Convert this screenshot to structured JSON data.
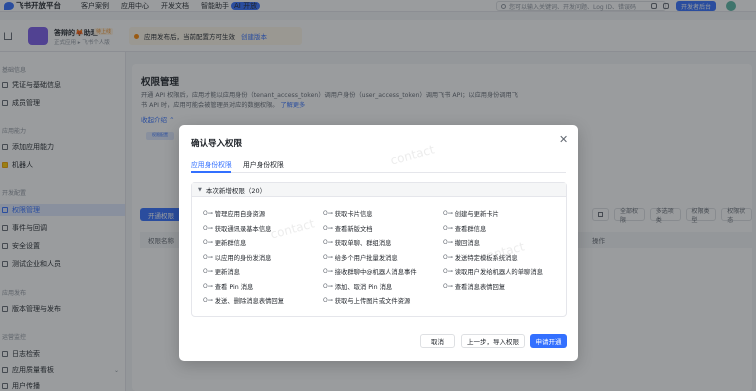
{
  "topbar": {
    "brand": "飞书开放平台",
    "nav": [
      "客户案例",
      "应用中心",
      "开发文档",
      "智能助手"
    ],
    "ai_badge": "AI 开放",
    "search_placeholder": "您可以输入关键词、开发问题、Log ID、错误码",
    "console_button": "开发者后台"
  },
  "app_header": {
    "app_name": "答辩的🦊助理",
    "app_tag": "待上线",
    "app_subtitle": "正式应用 ▸ 飞书个人版",
    "notice_text": "应用发布后，当前配置方可生效",
    "notice_link": "创建版本"
  },
  "sidebar": {
    "groups": [
      "基础信息",
      "应用能力",
      "开发配置",
      "应用发布",
      "运营监控"
    ],
    "items": [
      {
        "label": "凭证与基础信息"
      },
      {
        "label": "成员管理"
      },
      {
        "label": "添加应用能力"
      },
      {
        "label": "机器人"
      },
      {
        "label": "权限管理"
      },
      {
        "label": "事件与回调"
      },
      {
        "label": "安全设置"
      },
      {
        "label": "测试企业和人员"
      },
      {
        "label": "版本管理与发布"
      },
      {
        "label": "日志检索"
      },
      {
        "label": "应用质量看板"
      },
      {
        "label": "用户传播"
      }
    ]
  },
  "main": {
    "title": "权限管理",
    "description": "开通 API 权限后，应用才能以应用身份（tenant_access_token）调用户身份（user_access_token）调用飞书 API；以应用身份调用飞书 API 时，应用可能会被管理员对应的数据权限。",
    "learn_more": "了解更多",
    "collapse": "收起介绍 ⌃",
    "tab_chip": "权限配置",
    "open_button": "开通权限",
    "filters": [
      "全部权限",
      "多选项类",
      "权限类型",
      "权限状态"
    ],
    "table_headers": [
      "权限名称",
      "操作"
    ]
  },
  "modal": {
    "title": "确认导入权限",
    "tabs": [
      "应用身份权限",
      "用户身份权限"
    ],
    "section_title": "本次新增权限（20）",
    "permissions": [
      "管理应用自身资源",
      "获取卡片信息",
      "创建与更新卡片",
      "获取通讯录基本信息",
      "查看新版文档",
      "查看群信息",
      "更新群信息",
      "获取单聊、群组消息",
      "撤回消息",
      "以应用的身份发消息",
      "给多个用户批量发消息",
      "发送特定模板系统消息",
      "更新消息",
      "接收群聊中@机器人消息事件",
      "读取用户发给机器人的单聊消息",
      "查看 Pin 消息",
      "添加、取消 Pin 消息",
      "查看消息表情回复",
      "发送、删除消息表情回复",
      "获取与上传图片或文件资源"
    ],
    "cancel": "取消",
    "back_import": "上一步，导入权限",
    "apply": "申请开通"
  },
  "watermark": "contact"
}
